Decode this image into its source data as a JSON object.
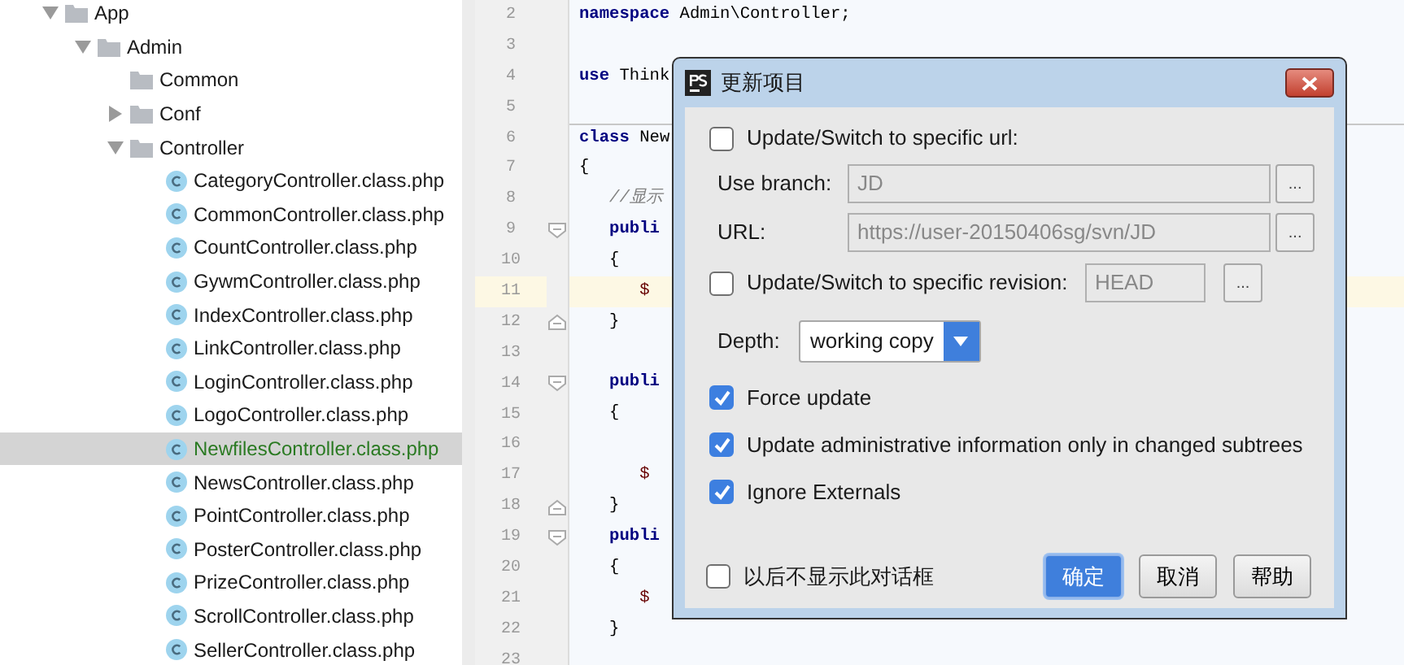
{
  "project_tree": {
    "items": [
      {
        "label": "App",
        "kind": "folder",
        "expanded": true,
        "children": [
          {
            "label": "Admin",
            "kind": "folder",
            "expanded": true,
            "children": [
              {
                "label": "Common",
                "kind": "folder"
              },
              {
                "label": "Conf",
                "kind": "folder",
                "expanded": false
              },
              {
                "label": "Controller",
                "kind": "folder",
                "expanded": true,
                "children": [
                  {
                    "label": "CategoryController.class.php",
                    "kind": "class",
                    "selected": false
                  },
                  {
                    "label": "CommonController.class.php",
                    "kind": "class",
                    "selected": false
                  },
                  {
                    "label": "CountController.class.php",
                    "kind": "class",
                    "selected": false
                  },
                  {
                    "label": "GywmController.class.php",
                    "kind": "class",
                    "selected": false
                  },
                  {
                    "label": "IndexController.class.php",
                    "kind": "class",
                    "selected": false
                  },
                  {
                    "label": "LinkController.class.php",
                    "kind": "class",
                    "selected": false
                  },
                  {
                    "label": "LoginController.class.php",
                    "kind": "class",
                    "selected": false
                  },
                  {
                    "label": "LogoController.class.php",
                    "kind": "class",
                    "selected": false
                  },
                  {
                    "label": "NewfilesController.class.php",
                    "kind": "class",
                    "selected": true
                  },
                  {
                    "label": "NewsController.class.php",
                    "kind": "class",
                    "selected": false
                  },
                  {
                    "label": "PointController.class.php",
                    "kind": "class",
                    "selected": false
                  },
                  {
                    "label": "PosterController.class.php",
                    "kind": "class",
                    "selected": false
                  },
                  {
                    "label": "PrizeController.class.php",
                    "kind": "class",
                    "selected": false
                  },
                  {
                    "label": "ScrollController.class.php",
                    "kind": "class",
                    "selected": false
                  },
                  {
                    "label": "SellerController.class.php",
                    "kind": "class",
                    "selected": false
                  }
                ]
              }
            ]
          }
        ]
      }
    ]
  },
  "editor": {
    "lines": [
      {
        "number": "2",
        "code": "**namespace** Admin\\Controller;"
      },
      {
        "number": "3"
      },
      {
        "number": "4",
        "code": "**use** Think"
      },
      {
        "number": "5"
      },
      {
        "number": "6",
        "code": "**class** New",
        "separator_above": true
      },
      {
        "number": "7",
        "code": "{"
      },
      {
        "number": "8",
        "code": "   //显示",
        "kind": "comment"
      },
      {
        "number": "9",
        "code": "   **publi**",
        "fold_start": true
      },
      {
        "number": "10",
        "code": "   {"
      },
      {
        "number": "11",
        "code": "      $",
        "kind": "variable",
        "current": true
      },
      {
        "number": "12",
        "code": "   }",
        "fold_end": true
      },
      {
        "number": "13"
      },
      {
        "number": "14",
        "code": "   **publi**",
        "fold_start": true
      },
      {
        "number": "15",
        "code": "   {"
      },
      {
        "number": "16"
      },
      {
        "number": "17",
        "code": "      $",
        "kind": "variable"
      },
      {
        "number": "18",
        "code": "   }",
        "fold_end": true
      },
      {
        "number": "19",
        "code": "   **publi**",
        "fold_start": true
      },
      {
        "number": "20",
        "code": "   {"
      },
      {
        "number": "21",
        "code": "      $",
        "kind": "variable"
      },
      {
        "number": "22",
        "code": "   }"
      },
      {
        "number": "23"
      }
    ]
  },
  "dialog": {
    "title": "更新项目",
    "url_option": {
      "label": "Update/Switch to specific url:",
      "checked": false
    },
    "fields": [
      {
        "label": "Use branch:",
        "value": "JD",
        "disabled": true,
        "browse": "..."
      },
      {
        "label": "URL:",
        "value": "https://user-20150406sg/svn/JD",
        "disabled": true,
        "browse": "..."
      }
    ],
    "revision_option": {
      "label": "Update/Switch to specific revision:",
      "checked": false,
      "value": "HEAD",
      "disabled": true,
      "browse": "..."
    },
    "depth": {
      "label": "Depth:",
      "value": "working copy"
    },
    "options": [
      {
        "label": "Force update",
        "checked": true
      },
      {
        "label": "Update administrative information only in changed subtrees",
        "checked": true
      },
      {
        "label": "Ignore Externals",
        "checked": true
      }
    ],
    "dont_show": {
      "label": "以后不显示此对话框",
      "checked": false
    },
    "buttons": [
      {
        "label": "确定",
        "default": true
      },
      {
        "label": "取消",
        "default": false
      },
      {
        "label": "帮助",
        "default": false
      }
    ]
  }
}
